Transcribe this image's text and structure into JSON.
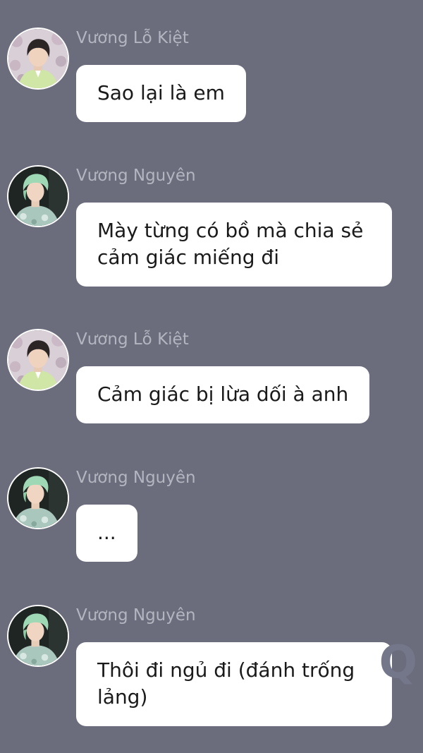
{
  "messages": [
    {
      "sender": "Vương Lỗ Kiệt",
      "text": "Sao lại là em",
      "avatar": "avatar-vuong-lo-kiet"
    },
    {
      "sender": "Vương Nguyên",
      "text": "Mày từng có bồ mà chia sẻ cảm giác miếng đi",
      "avatar": "avatar-vuong-nguyen"
    },
    {
      "sender": "Vương Lỗ Kiệt",
      "text": "Cảm giác bị lừa dối à anh",
      "avatar": "avatar-vuong-lo-kiet"
    },
    {
      "sender": "Vương Nguyên",
      "text": "...",
      "avatar": "avatar-vuong-nguyen"
    },
    {
      "sender": "Vương Nguyên",
      "text": "Thôi đi ngủ đi (đánh trống lảng)",
      "avatar": "avatar-vuong-nguyen"
    }
  ],
  "watermark": "Q",
  "colors": {
    "background": "#6b6d7c",
    "bubble": "#ffffff",
    "sender_name": "#b3b5c1",
    "message_text": "#1a1a1a"
  }
}
